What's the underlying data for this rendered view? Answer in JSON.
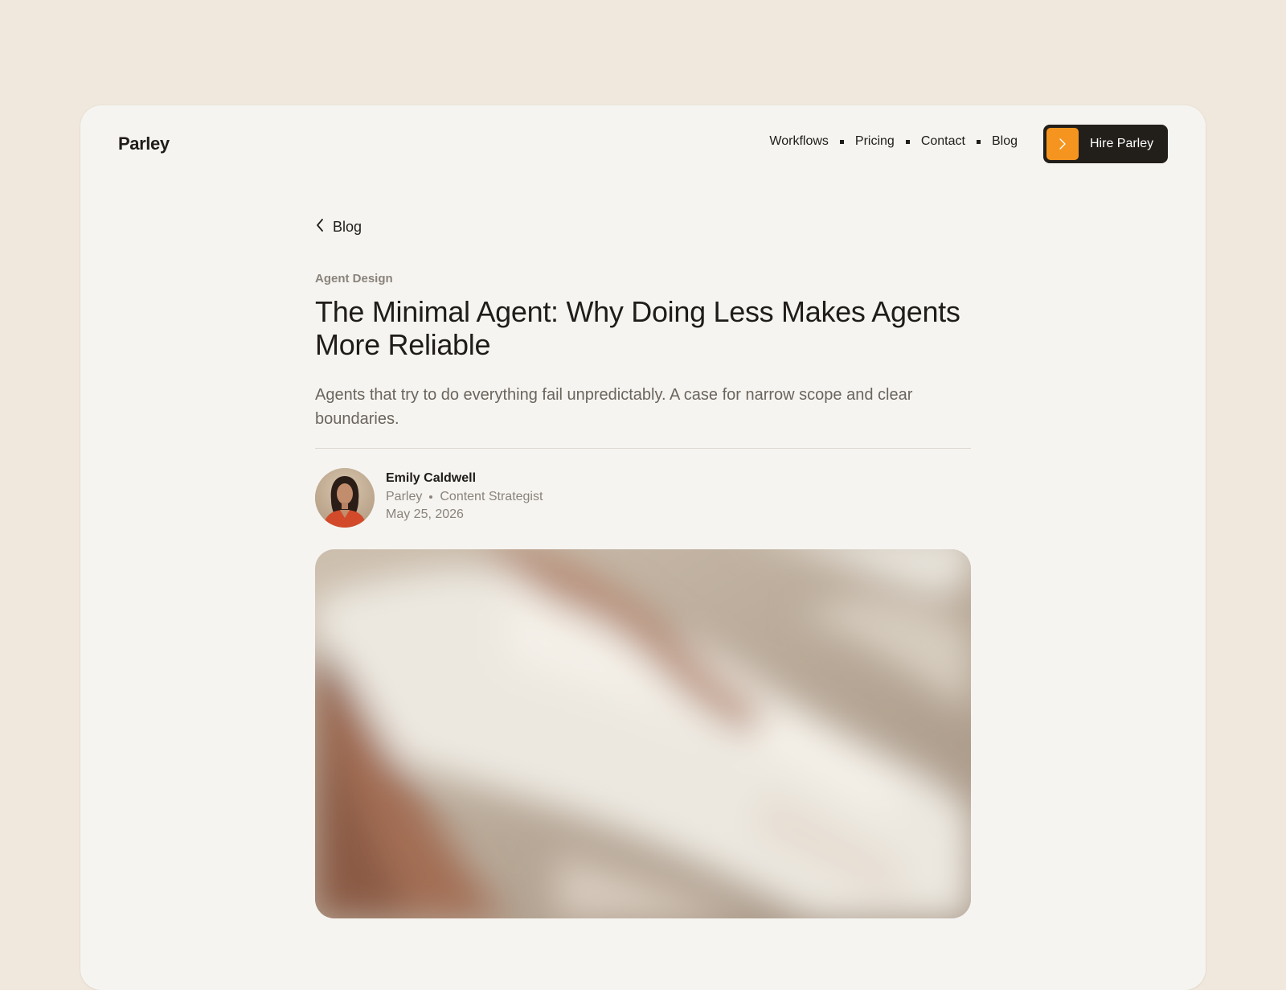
{
  "brand": {
    "name": "Parley"
  },
  "nav": {
    "items": [
      "Workflows",
      "Pricing",
      "Contact",
      "Blog"
    ],
    "cta_label": "Hire Parley"
  },
  "colors": {
    "accent": "#f5951f",
    "dark": "#221e1a",
    "page_bg": "#f0e8dd",
    "card_bg": "#f5f4f0"
  },
  "article": {
    "back_label": "Blog",
    "category": "Agent Design",
    "title": "The Minimal Agent: Why Doing Less Makes Agents More Reliable",
    "subtitle": "Agents that try to do everything fail unpredictably. A case for narrow scope and clear boundaries.",
    "author": {
      "name": "Emily Caldwell",
      "company": "Parley",
      "role": "Content Strategist",
      "date": "May 25, 2026"
    }
  },
  "icons": {
    "back": "chevron-left-icon",
    "cta": "chevron-right-icon"
  }
}
